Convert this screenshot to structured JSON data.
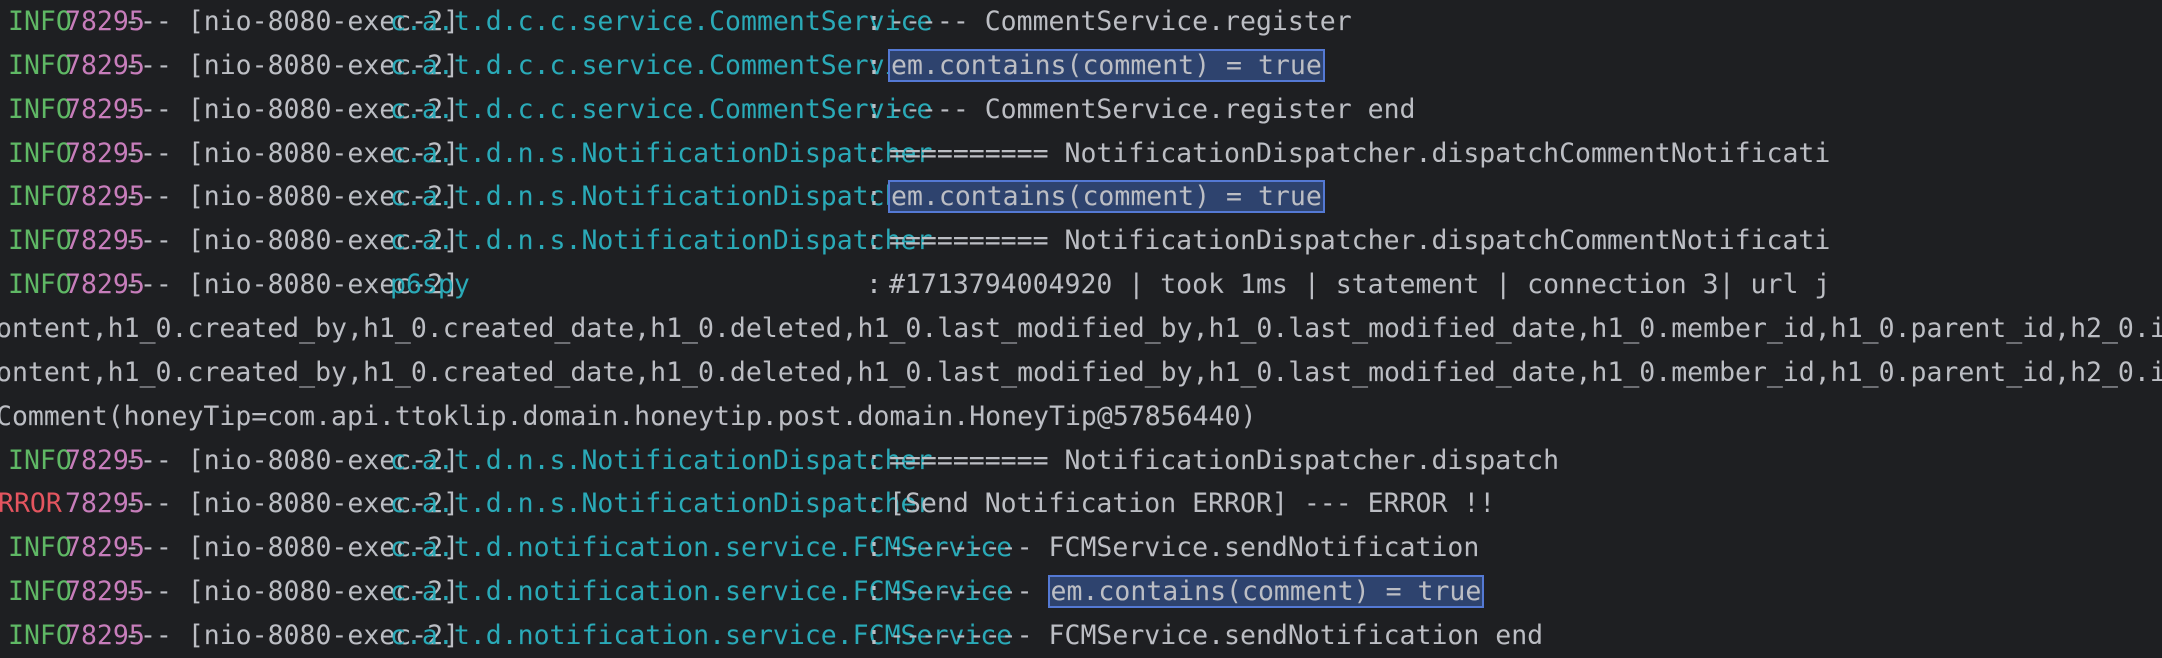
{
  "console": {
    "lines": [
      {
        "type": "log",
        "level": "INFO",
        "pid": "78295",
        "thread": "--- [nio-8080-exec-2]",
        "logger": "c.a.t.d.c.c.service.CommentService",
        "sep": ":",
        "pre": "----- CommentService.register",
        "highlight": ""
      },
      {
        "type": "log",
        "level": "INFO",
        "pid": "78295",
        "thread": "--- [nio-8080-exec-2]",
        "logger": "c.a.t.d.c.c.service.CommentService",
        "sep": ":",
        "pre": "",
        "highlight": "em.contains(comment) = true"
      },
      {
        "type": "log",
        "level": "INFO",
        "pid": "78295",
        "thread": "--- [nio-8080-exec-2]",
        "logger": "c.a.t.d.c.c.service.CommentService",
        "sep": ":",
        "pre": "----- CommentService.register end",
        "highlight": ""
      },
      {
        "type": "log",
        "level": "INFO",
        "pid": "78295",
        "thread": "--- [nio-8080-exec-2]",
        "logger": "c.a.t.d.n.s.NotificationDispatcher",
        "sep": ":",
        "pre": "========== NotificationDispatcher.dispatchCommentNotificati",
        "highlight": ""
      },
      {
        "type": "log",
        "level": "INFO",
        "pid": "78295",
        "thread": "--- [nio-8080-exec-2]",
        "logger": "c.a.t.d.n.s.NotificationDispatcher",
        "sep": ":",
        "pre": "",
        "highlight": "em.contains(comment) = true"
      },
      {
        "type": "log",
        "level": "INFO",
        "pid": "78295",
        "thread": "--- [nio-8080-exec-2]",
        "logger": "c.a.t.d.n.s.NotificationDispatcher",
        "sep": ":",
        "pre": "========== NotificationDispatcher.dispatchCommentNotificati",
        "highlight": ""
      },
      {
        "type": "log",
        "level": "INFO",
        "pid": "78295",
        "thread": "--- [nio-8080-exec-2]",
        "logger": "p6spy",
        "sep": ":",
        "pre": "#1713794004920 | took 1ms | statement | connection 3| url j",
        "highlight": ""
      },
      {
        "type": "raw",
        "text": "ontent,h1_0.created_by,h1_0.created_date,h1_0.deleted,h1_0.last_modified_by,h1_0.last_modified_date,h1_0.member_id,h1_0.parent_id,h2_0.i"
      },
      {
        "type": "raw",
        "text": "ontent,h1_0.created_by,h1_0.created_date,h1_0.deleted,h1_0.last_modified_by,h1_0.last_modified_date,h1_0.member_id,h1_0.parent_id,h2_0.i"
      },
      {
        "type": "raw",
        "text": "Comment(honeyTip=com.api.ttoklip.domain.honeytip.post.domain.HoneyTip@57856440)"
      },
      {
        "type": "log",
        "level": "INFO",
        "pid": "78295",
        "thread": "--- [nio-8080-exec-2]",
        "logger": "c.a.t.d.n.s.NotificationDispatcher",
        "sep": ":",
        "pre": "========== NotificationDispatcher.dispatch",
        "highlight": ""
      },
      {
        "type": "log",
        "level": "RROR",
        "pid": "78295",
        "thread": "--- [nio-8080-exec-2]",
        "logger": "c.a.t.d.n.s.NotificationDispatcher",
        "sep": ":",
        "pre": "[Send Notification ERROR] --- ERROR !!",
        "highlight": ""
      },
      {
        "type": "log",
        "level": "INFO",
        "pid": "78295",
        "thread": "--- [nio-8080-exec-2]",
        "logger": "c.a.t.d.notification.service.FCMService",
        "sep": ":",
        "pre": "--------- FCMService.sendNotification",
        "highlight": ""
      },
      {
        "type": "log",
        "level": "INFO",
        "pid": "78295",
        "thread": "--- [nio-8080-exec-2]",
        "logger": "c.a.t.d.notification.service.FCMService",
        "sep": ":",
        "pre": "--------- ",
        "highlight": "em.contains(comment) = true"
      },
      {
        "type": "log",
        "level": "INFO",
        "pid": "78295",
        "thread": "--- [nio-8080-exec-2]",
        "logger": "c.a.t.d.notification.service.FCMService",
        "sep": ":",
        "pre": "--------- FCMService.sendNotification end",
        "highlight": ""
      }
    ]
  },
  "colors": {
    "background": "#1e1f22",
    "info": "#5fb865",
    "error": "#e4555f",
    "pid": "#c77dbb",
    "logger": "#2aaab8",
    "text": "#bcbec4",
    "highlight_bg": "#2e436e",
    "highlight_border": "#5479d4"
  }
}
